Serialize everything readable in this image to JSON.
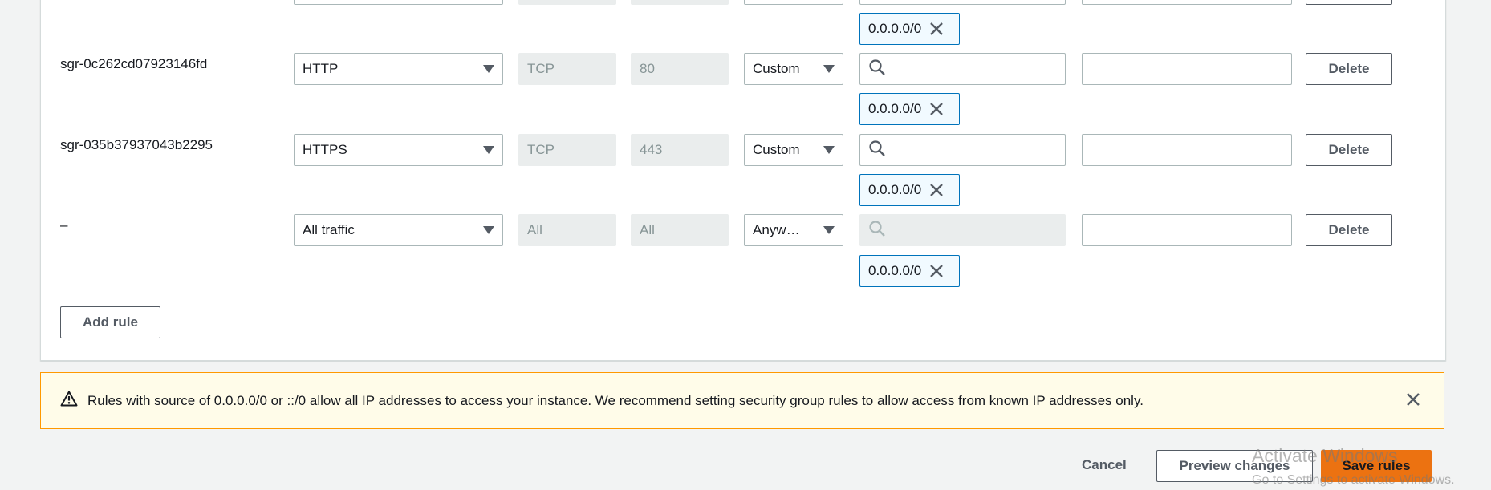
{
  "rules": [
    {
      "id": "",
      "type": "",
      "protocol": "",
      "port": "",
      "source_type": "",
      "cidr": "0.0.0.0/0",
      "delete_label": ""
    },
    {
      "id": "sgr-0c262cd07923146fd",
      "type": "HTTP",
      "protocol": "TCP",
      "port": "80",
      "source_type": "Custom",
      "cidr": "0.0.0.0/0",
      "delete_label": "Delete"
    },
    {
      "id": "sgr-035b37937043b2295",
      "type": "HTTPS",
      "protocol": "TCP",
      "port": "443",
      "source_type": "Custom",
      "cidr": "0.0.0.0/0",
      "delete_label": "Delete"
    },
    {
      "id": "–",
      "type": "All traffic",
      "protocol": "All",
      "port": "All",
      "source_type": "Anyw…",
      "cidr": "0.0.0.0/0",
      "delete_label": "Delete"
    }
  ],
  "add_rule_label": "Add rule",
  "alert": {
    "text": "Rules with source of 0.0.0.0/0 or ::/0 allow all IP addresses to access your instance. We recommend setting security group rules to allow access from known IP addresses only."
  },
  "footer": {
    "cancel_label": "Cancel",
    "preview_label": "Preview changes",
    "save_label": "Save rules"
  },
  "watermark": {
    "title": "Activate Windows",
    "subtitle": "Go to Settings to activate Windows."
  },
  "icons": {
    "search": "search-icon",
    "remove_token": "close-icon",
    "warning": "warning-icon",
    "dismiss": "close-icon",
    "dropdown": "caret-down-icon"
  },
  "colors": {
    "primary": "#ec7211",
    "token_border": "#0073bb",
    "alert_border": "#ff9900",
    "alert_bg": "#fffce9"
  }
}
